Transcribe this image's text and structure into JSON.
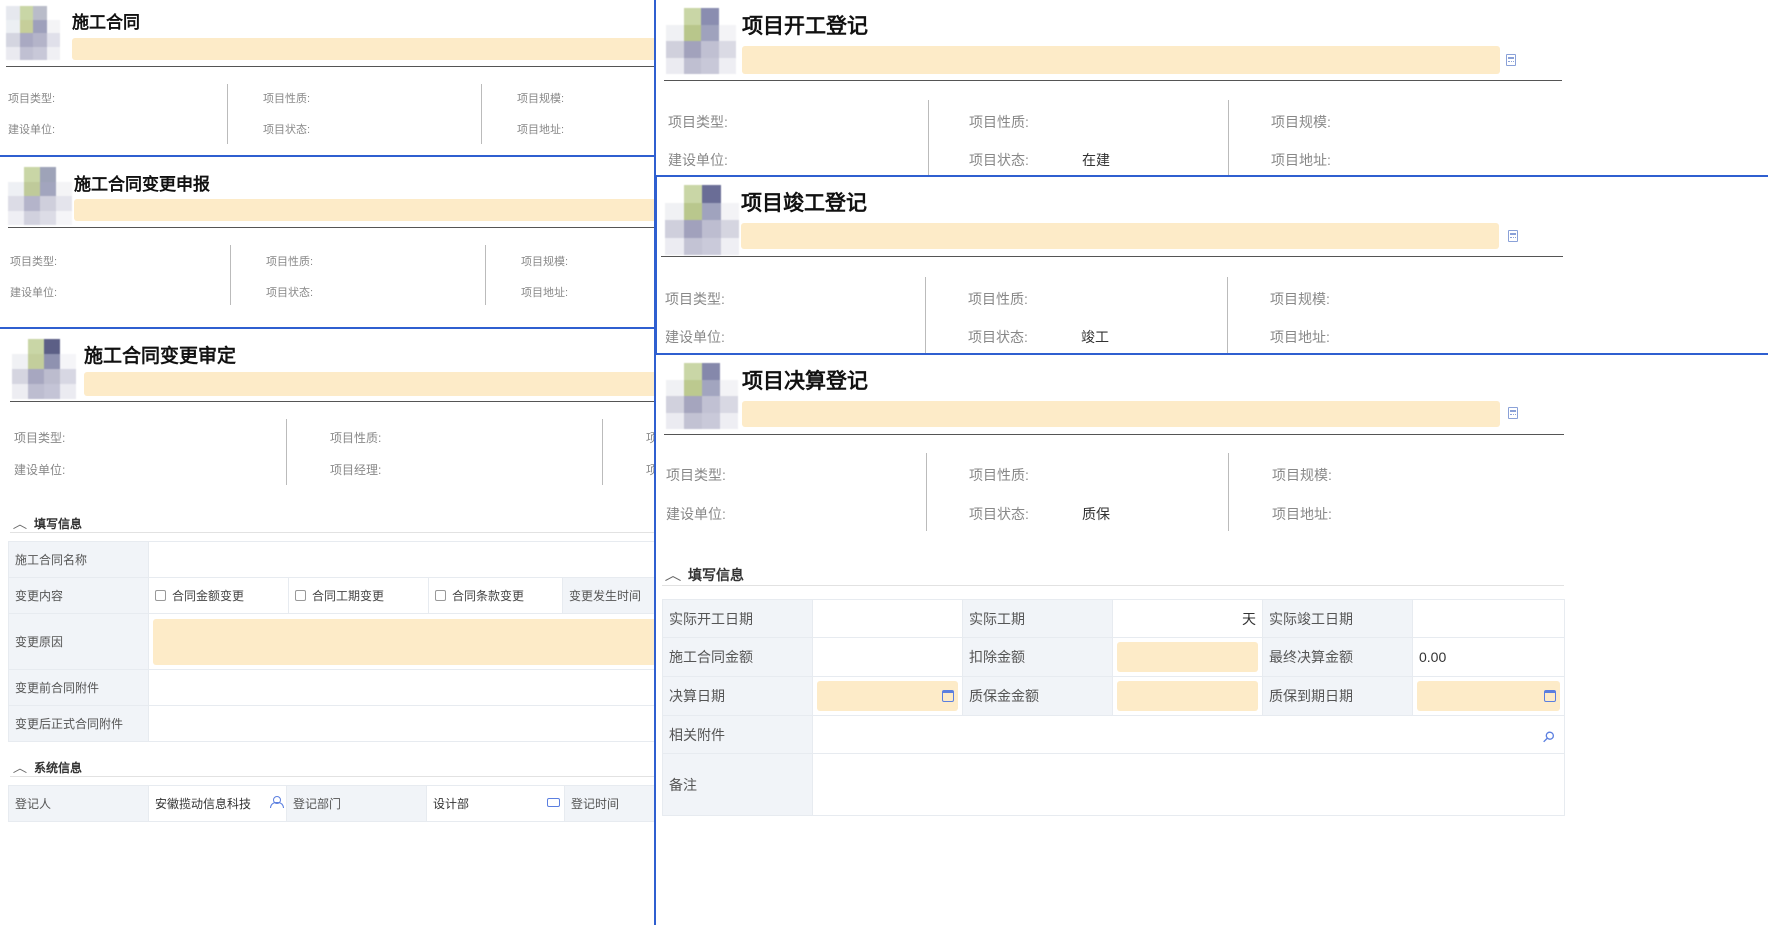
{
  "meta_labels": {
    "type": "项目类型:",
    "nature": "项目性质:",
    "scale": "项目规模:",
    "unit": "建设单位:",
    "status": "项目状态:",
    "address": "项目地址:",
    "manager": "项目经理:"
  },
  "panels": {
    "contract": {
      "title": "施工合同"
    },
    "change_report": {
      "title": "施工合同变更申报"
    },
    "change_approve": {
      "title": "施工合同变更审定"
    },
    "start_reg": {
      "title": "项目开工登记",
      "status_value": "在建"
    },
    "complete_reg": {
      "title": "项目竣工登记",
      "status_value": "竣工"
    },
    "settle_reg": {
      "title": "项目决算登记",
      "status_value": "质保"
    }
  },
  "change_form": {
    "section_title": "填写信息",
    "contract_name_label": "施工合同名称",
    "change_content_label": "变更内容",
    "options": [
      "合同金额变更",
      "合同工期变更",
      "合同条款变更"
    ],
    "change_time_label": "变更发生时间",
    "reason_label": "变更原因",
    "before_attach_label": "变更前合同附件",
    "after_attach_label": "变更后正式合同附件"
  },
  "system_info": {
    "section_title": "系统信息",
    "registrar_label": "登记人",
    "registrar_value": "安徽揽动信息科技",
    "dept_label": "登记部门",
    "dept_value": "设计部",
    "time_label": "登记时间"
  },
  "settle_form": {
    "section_title": "填写信息",
    "actual_start_label": "实际开工日期",
    "actual_period_label": "实际工期",
    "period_unit": "天",
    "actual_complete_label": "实际竣工日期",
    "contract_amount_label": "施工合同金额",
    "deduct_label": "扣除金额",
    "final_amount_label": "最终决算金额",
    "final_amount_value": "0.00",
    "settle_date_label": "决算日期",
    "warranty_amount_label": "质保金金额",
    "warranty_due_label": "质保到期日期",
    "attach_label": "相关附件",
    "remark_label": "备注"
  }
}
